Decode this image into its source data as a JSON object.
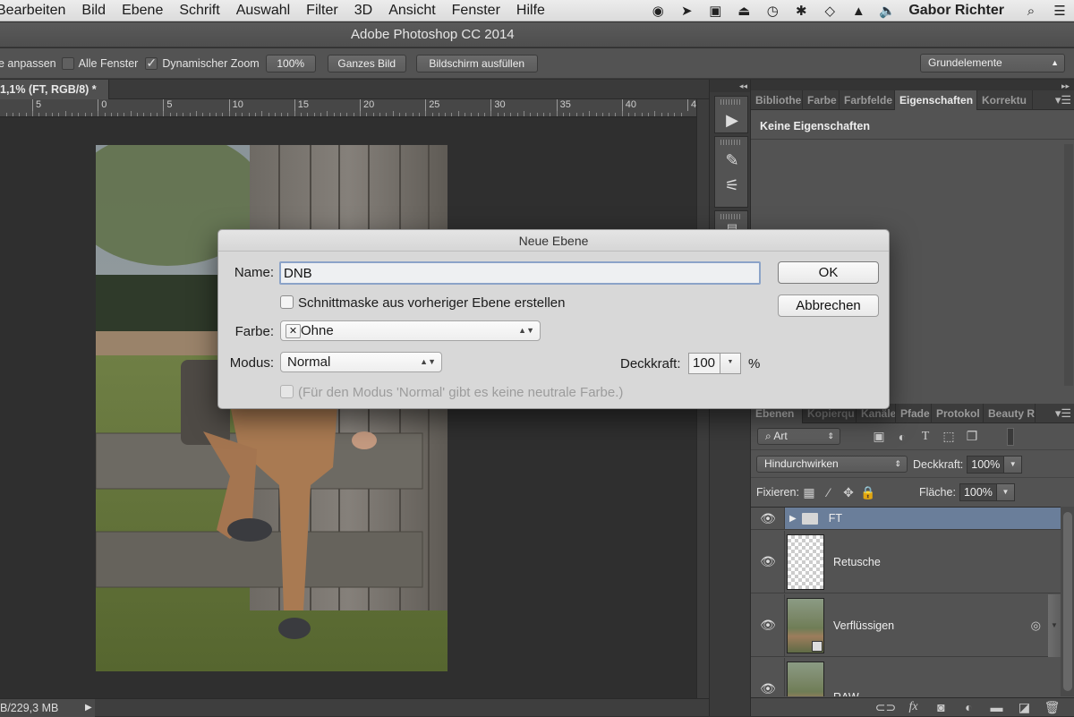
{
  "menubar": {
    "items": [
      "Bearbeiten",
      "Bild",
      "Ebene",
      "Schrift",
      "Auswahl",
      "Filter",
      "3D",
      "Ansicht",
      "Fenster",
      "Hilfe"
    ],
    "status_icons": [
      "record-icon",
      "arrows-icon",
      "display-icon",
      "airplay-icon",
      "time-machine-icon",
      "bluetooth-icon",
      "wifi-icon",
      "eject-icon",
      "volume-icon"
    ],
    "user": "Gabor Richter"
  },
  "window": {
    "title": "Adobe Photoshop CC 2014"
  },
  "options_bar": {
    "fit_label": "e anpassen",
    "all_windows_label": "Alle Fenster",
    "all_windows_checked": false,
    "dynamic_zoom_label": "Dynamischer Zoom",
    "dynamic_zoom_checked": true,
    "zoom_100_label": "100%",
    "fit_screen_label": "Ganzes Bild",
    "fill_screen_label": "Bildschirm ausfüllen",
    "workspace": "Grundelemente"
  },
  "document": {
    "tab_label": "1,1% (FT, RGB/8) *",
    "ruler_labels": [
      "5",
      "0",
      "5",
      "10",
      "15",
      "20",
      "25",
      "30",
      "35",
      "40",
      "4"
    ],
    "status_text": "B/229,3 MB"
  },
  "properties_panel": {
    "tabs": [
      "Bibliothe",
      "Farbe",
      "Farbfelde",
      "Eigenschaften",
      "Korrektu"
    ],
    "active_tab": 3,
    "content": "Keine Eigenschaften"
  },
  "layers_panel": {
    "tabs": [
      "Ebenen",
      "Kopierqu",
      "Kanäle",
      "Pfade",
      "Protokol",
      "Beauty R"
    ],
    "active_tab": 0,
    "filter_kind": "Art",
    "blend_mode": "Hindurchwirken",
    "opacity_label": "Deckkraft:",
    "opacity": "100%",
    "lock_label": "Fixieren:",
    "fill_label": "Fläche:",
    "fill": "100%",
    "layers": [
      {
        "name": "FT",
        "type": "group",
        "visible": true,
        "selected": true
      },
      {
        "name": "Retusche",
        "type": "pixel-transparent",
        "visible": true,
        "selected": false
      },
      {
        "name": "Verflüssigen",
        "type": "smart-object",
        "visible": true,
        "selected": false
      },
      {
        "name": "RAW",
        "type": "pixel-photo",
        "visible": true,
        "selected": false
      }
    ]
  },
  "dialog": {
    "title": "Neue Ebene",
    "name_label": "Name:",
    "name_value": "DNB",
    "clip_label": "Schnittmaske aus vorheriger Ebene erstellen",
    "clip_checked": false,
    "color_label": "Farbe:",
    "color_value": "Ohne",
    "mode_label": "Modus:",
    "mode_value": "Normal",
    "opacity_label": "Deckkraft:",
    "opacity_value": "100",
    "opacity_unit": "%",
    "neutral_label": "(Für den Modus 'Normal' gibt es keine neutrale Farbe.)",
    "neutral_checked": false,
    "neutral_enabled": false,
    "ok_label": "OK",
    "cancel_label": "Abbrechen"
  }
}
